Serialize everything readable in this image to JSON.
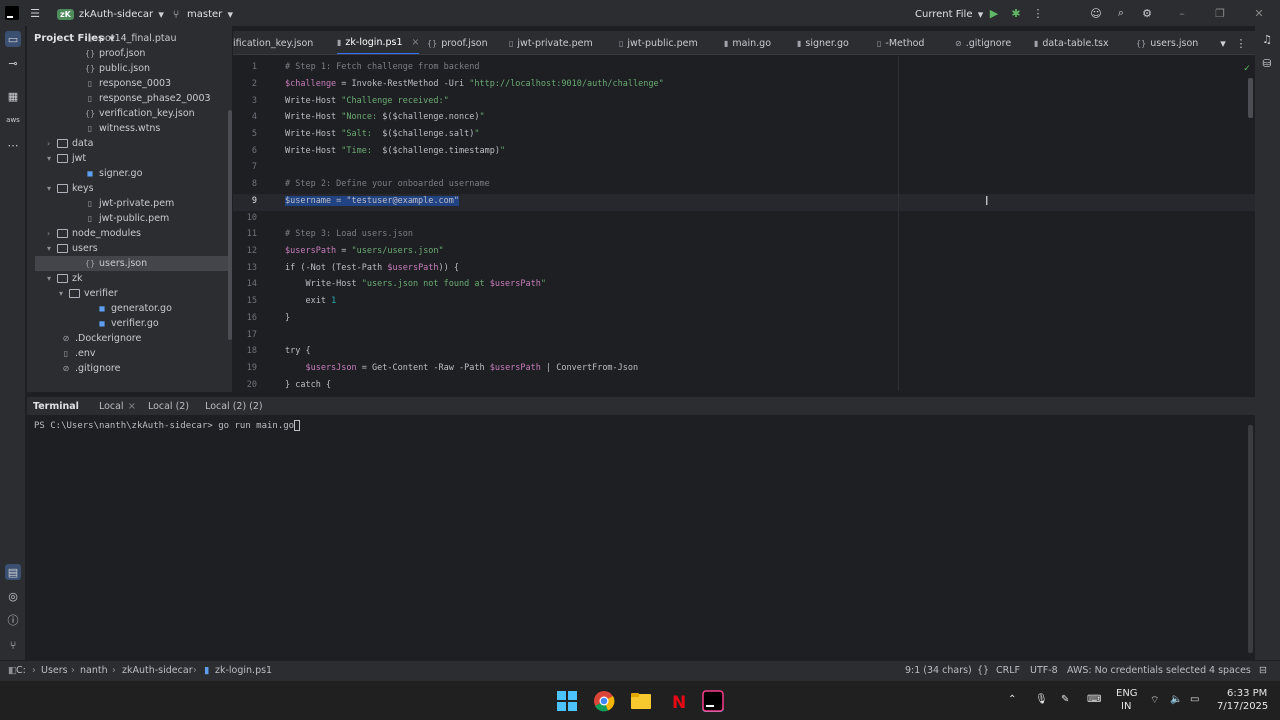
{
  "titlebar": {
    "project_badge": "zK",
    "project_name": "zkAuth-sidecar",
    "branch": "master",
    "run_config": "Current File"
  },
  "project_panel": {
    "title": "Project Files",
    "items": [
      {
        "label": "pot14_final.ptau",
        "kind": "file"
      },
      {
        "label": "proof.json",
        "kind": "json"
      },
      {
        "label": "public.json",
        "kind": "json"
      },
      {
        "label": "response_0003",
        "kind": "file"
      },
      {
        "label": "response_phase2_0003",
        "kind": "file"
      },
      {
        "label": "verification_key.json",
        "kind": "json"
      },
      {
        "label": "witness.wtns",
        "kind": "file"
      },
      {
        "label": "data",
        "kind": "folder-closed"
      },
      {
        "label": "jwt",
        "kind": "folder-open"
      },
      {
        "label": "signer.go",
        "kind": "go"
      },
      {
        "label": "keys",
        "kind": "folder-open"
      },
      {
        "label": "jwt-private.pem",
        "kind": "file"
      },
      {
        "label": "jwt-public.pem",
        "kind": "file"
      },
      {
        "label": "node_modules",
        "kind": "folder-closed"
      },
      {
        "label": "users",
        "kind": "folder-open"
      },
      {
        "label": "users.json",
        "kind": "json"
      },
      {
        "label": "zk",
        "kind": "folder-open"
      },
      {
        "label": "verifier",
        "kind": "folder-open"
      },
      {
        "label": "generator.go",
        "kind": "go"
      },
      {
        "label": "verifier.go",
        "kind": "go"
      },
      {
        "label": ".Dockerignore",
        "kind": "ignore"
      },
      {
        "label": ".env",
        "kind": "file"
      },
      {
        "label": ".gitignore",
        "kind": "ignore"
      }
    ]
  },
  "tabs": [
    {
      "label": "ification_key.json"
    },
    {
      "label": "zk-login.ps1",
      "active": true
    },
    {
      "label": "proof.json"
    },
    {
      "label": "jwt-private.pem"
    },
    {
      "label": "jwt-public.pem"
    },
    {
      "label": "main.go"
    },
    {
      "label": "signer.go"
    },
    {
      "label": "-Method"
    },
    {
      "label": ".gitignore"
    },
    {
      "label": "data-table.tsx"
    },
    {
      "label": "users.json"
    }
  ],
  "editor": {
    "line_numbers": [
      "1",
      "2",
      "3",
      "4",
      "5",
      "6",
      "7",
      "8",
      "9",
      "10",
      "11",
      "12",
      "13",
      "14",
      "15",
      "16",
      "17",
      "18",
      "19",
      "20"
    ],
    "lines": {
      "l1": "# Step 1: Fetch challenge from backend",
      "l2a": "$challenge",
      "l2b": " = Invoke-RestMethod -Uri ",
      "l2c": "\"http://localhost:9010/auth/challenge\"",
      "l3a": "Write-Host ",
      "l3b": "\"Challenge received:\"",
      "l4a": "Write-Host ",
      "l4b": "\"Nonce: ",
      "l4c": "$($challenge.nonce)",
      "l4d": "\"",
      "l5a": "Write-Host ",
      "l5b": "\"Salt:  ",
      "l5c": "$($challenge.salt)",
      "l5d": "\"",
      "l6a": "Write-Host ",
      "l6b": "\"Time:  ",
      "l6c": "$($challenge.timestamp)",
      "l6d": "\"",
      "l8": "# Step 2: Define your onboarded username",
      "l9": "$username = \"testuser@example.com\"",
      "l11": "# Step 3: Load users.json",
      "l12a": "$usersPath",
      "l12b": " = ",
      "l12c": "\"users/users.json\"",
      "l13a": "if (-Not (Test-Path ",
      "l13b": "$usersPath",
      "l13c": ")) {",
      "l14a": "    Write-Host ",
      "l14b": "\"users.json not found at ",
      "l14c": "$usersPath",
      "l14d": "\"",
      "l15a": "    exit ",
      "l15b": "1",
      "l16": "}",
      "l18": "try {",
      "l19a": "    $usersJson",
      "l19b": " = Get-Content -Raw -Path ",
      "l19c": "$usersPath",
      "l19d": " | ConvertFrom-Json",
      "l20": "} catch {"
    }
  },
  "terminal": {
    "tabs": [
      "Terminal",
      "Local",
      "Local (2)",
      "Local (2) (2)"
    ],
    "prompt": "PS C:\\Users\\nanth\\zkAuth-sidecar> go run main.go"
  },
  "statusbar": {
    "breadcrumb": [
      "C:",
      "Users",
      "nanth",
      "zkAuth-sidecar",
      "zk-login.ps1"
    ],
    "position": "9:1 (34 chars)",
    "line_sep": "CRLF",
    "encoding": "UTF-8",
    "aws": "AWS: No credentials selected",
    "indent": "4 spaces"
  },
  "taskbar": {
    "lang1": "ENG",
    "lang2": "IN",
    "time": "6:33 PM",
    "date": "7/17/2025"
  },
  "colors": {
    "accent": "#3574f0",
    "selection": "#214283",
    "string": "#6aab73"
  }
}
